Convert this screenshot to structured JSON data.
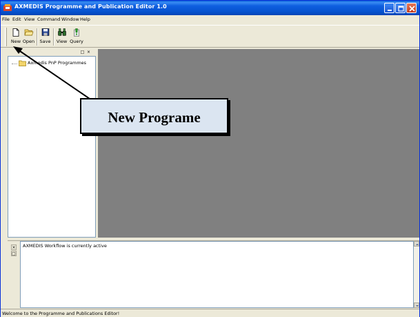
{
  "window": {
    "title": "AXMEDIS Programme and Publication Editor 1.0"
  },
  "menu": [
    "File",
    "Edit",
    "View",
    "Command",
    "Window",
    "Help"
  ],
  "toolbar": {
    "buttons": [
      {
        "label": "New",
        "icon": "new-document-icon"
      },
      {
        "label": "Open",
        "icon": "open-folder-icon"
      },
      {
        "label": "Save",
        "icon": "save-disk-icon"
      },
      {
        "label": "View",
        "icon": "binoculars-icon"
      },
      {
        "label": "Query",
        "icon": "query-icon"
      }
    ]
  },
  "tree": {
    "panel_controls": [
      "□",
      "×"
    ],
    "root_label": "Axmedis PnP Programmes"
  },
  "output": {
    "line": "AXMEDIS Workflow is currently active",
    "panel_controls": [
      "×",
      "□"
    ]
  },
  "status": {
    "text": "Welcome to the Programme and Publications Editor!"
  },
  "annotation": {
    "text": "New Programe"
  },
  "colors": {
    "titlebar": "#0653d0",
    "mdi_background": "#808080",
    "callout_fill": "#dbe5f1",
    "chrome": "#ece9d8"
  }
}
